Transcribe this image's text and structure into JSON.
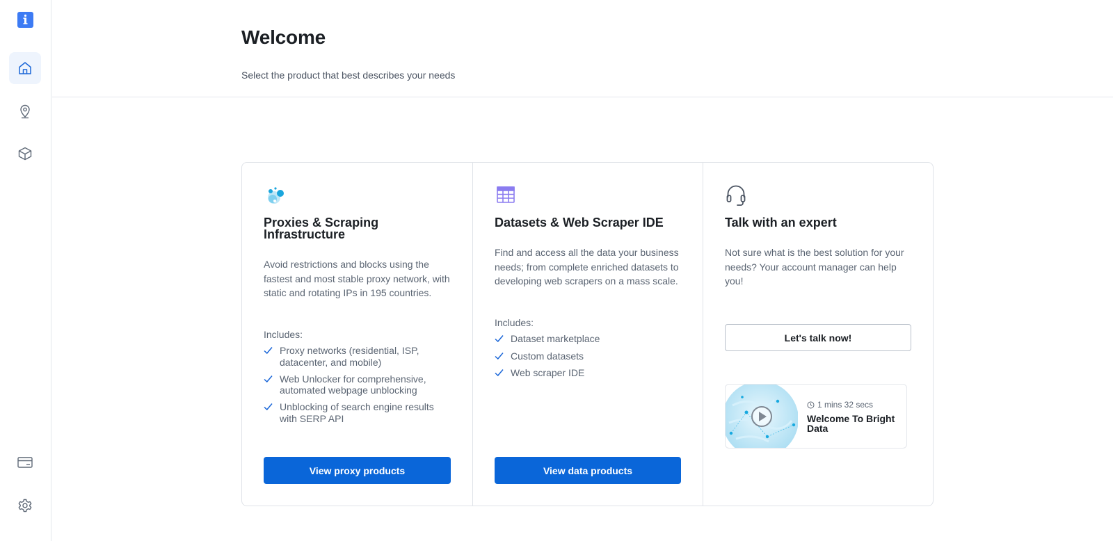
{
  "header": {
    "title": "Welcome",
    "subtitle": "Select the product that best describes your needs"
  },
  "sidebar": {
    "logo_icon": "info-icon",
    "items": [
      {
        "name": "home",
        "icon": "home-icon",
        "active": true
      },
      {
        "name": "locations",
        "icon": "location-pin-icon",
        "active": false
      },
      {
        "name": "products",
        "icon": "layers-icon",
        "active": false
      },
      {
        "name": "billing",
        "icon": "credit-card-icon",
        "active": false
      },
      {
        "name": "settings",
        "icon": "gear-icon",
        "active": false
      }
    ]
  },
  "cards": [
    {
      "icon": "proxy-bubbles-icon",
      "title": "Proxies & Scraping Infrastructure",
      "description": "Avoid restrictions and blocks using the fastest and most stable proxy network, with static and rotating IPs in 195 countries.",
      "includes_label": "Includes:",
      "includes": [
        "Proxy networks (residential, ISP, datacenter, and mobile)",
        "Web Unlocker for comprehensive, automated webpage unblocking",
        "Unblocking of search engine results with SERP API"
      ],
      "button_label": "View proxy products"
    },
    {
      "icon": "table-grid-icon",
      "title": "Datasets & Web Scraper IDE",
      "description": "Find and access all the data your business needs; from complete enriched datasets to developing web scrapers on a mass scale.",
      "includes_label": "Includes:",
      "includes": [
        "Dataset marketplace",
        "Custom datasets",
        "Web scraper IDE"
      ],
      "button_label": "View data products"
    },
    {
      "icon": "headset-icon",
      "title": "Talk with an expert",
      "description": "Not sure what is the best solution for your needs? Your account manager can help you!",
      "button_label": "Let's talk now!",
      "video": {
        "duration": "1 mins 32 secs",
        "title": "Welcome To Bright Data"
      }
    }
  ],
  "colors": {
    "primary": "#0a66d9",
    "accent_icon": "#3d7bf4",
    "nav_active_bg": "#eef4fd",
    "text_muted": "#5a6472",
    "border": "#dfe3e8"
  }
}
